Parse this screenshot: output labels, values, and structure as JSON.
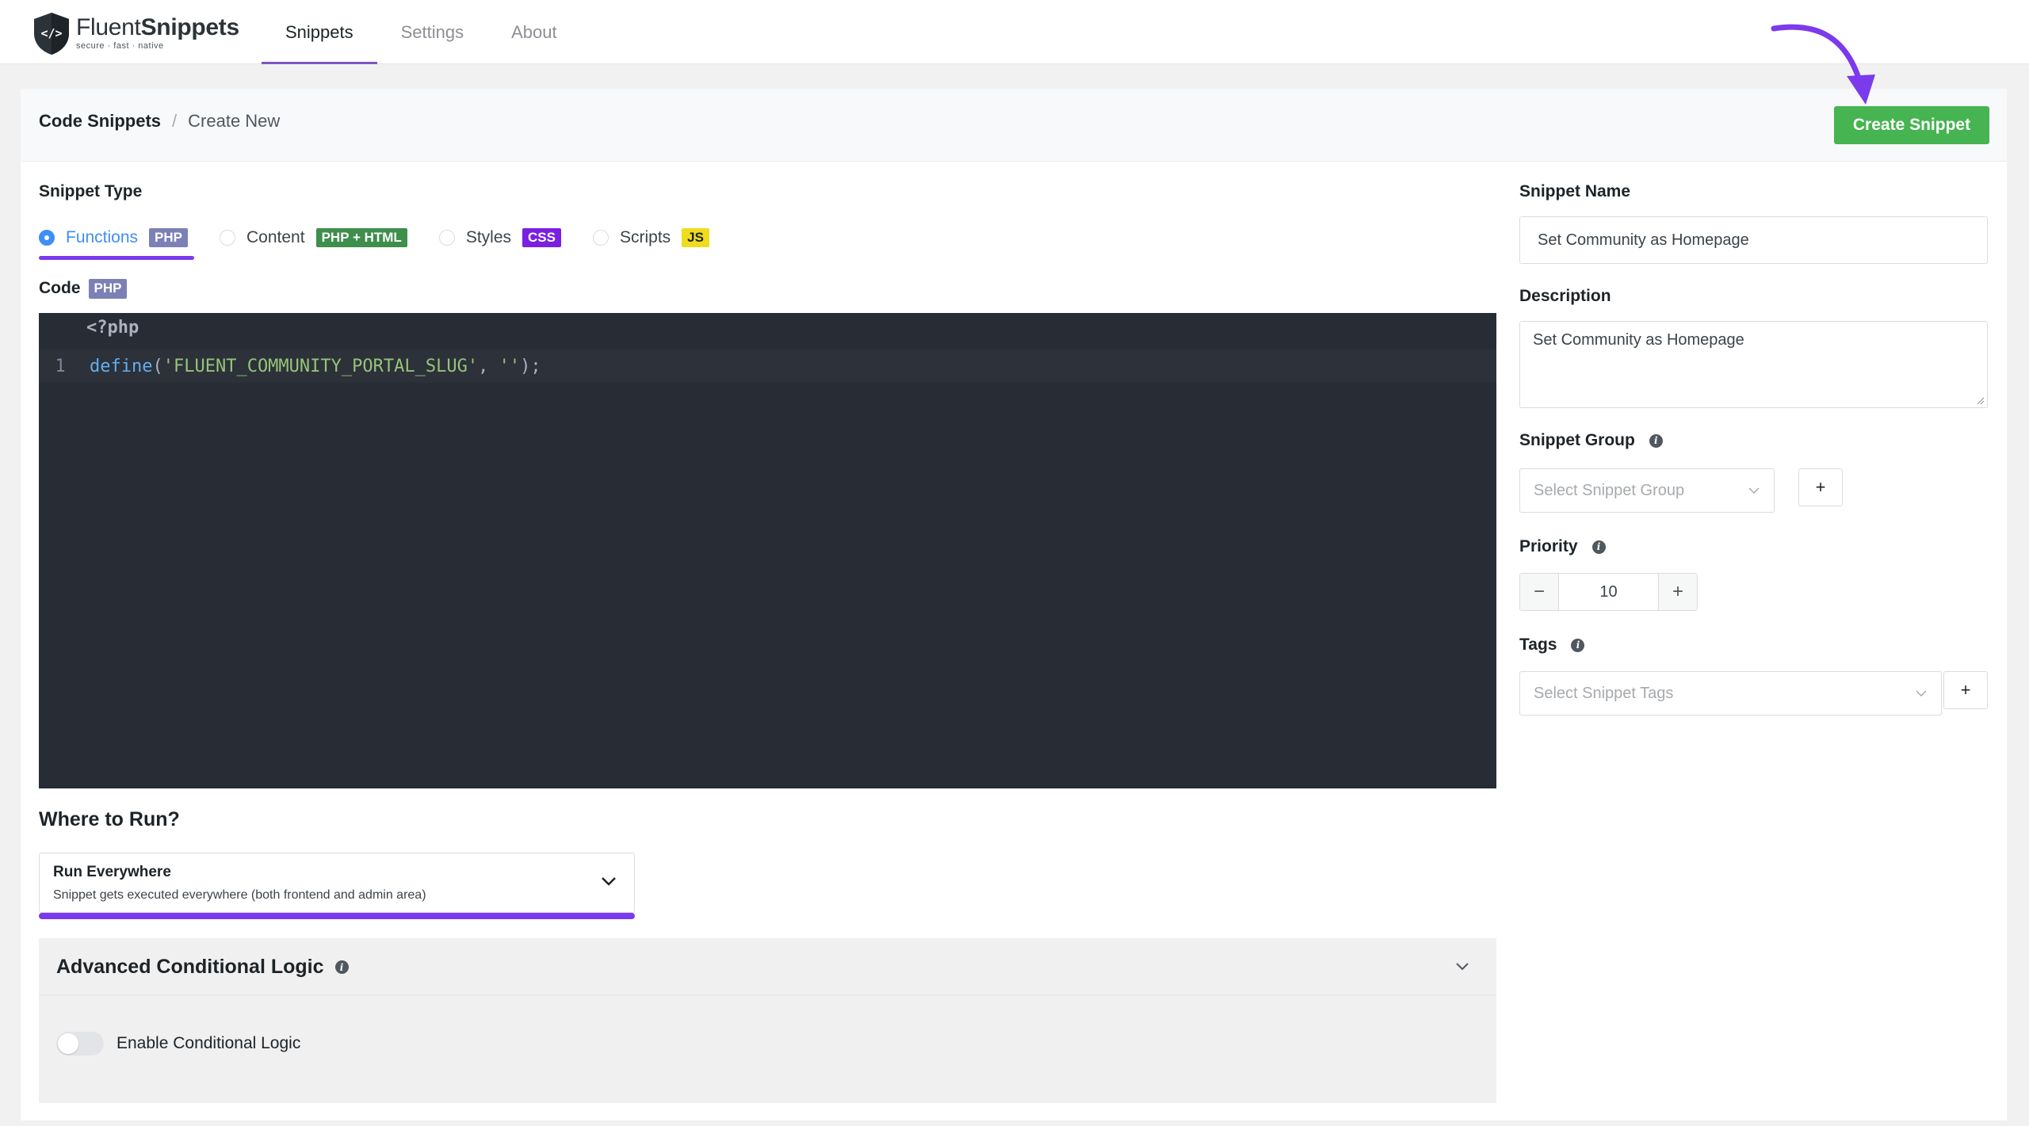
{
  "app": {
    "logo_name_light": "Fluent",
    "logo_name_bold": "Snippets",
    "logo_tagline": "secure · fast · native"
  },
  "nav": {
    "tabs": [
      {
        "label": "Snippets",
        "active": true
      },
      {
        "label": "Settings",
        "active": false
      },
      {
        "label": "About",
        "active": false
      }
    ]
  },
  "header": {
    "breadcrumb_root": "Code Snippets",
    "breadcrumb_sep": "/",
    "breadcrumb_current": "Create New",
    "create_button": "Create Snippet"
  },
  "snippet_type": {
    "label": "Snippet Type",
    "selected": "Functions",
    "options": [
      {
        "label": "Functions",
        "badge": "PHP"
      },
      {
        "label": "Content",
        "badge": "PHP + HTML"
      },
      {
        "label": "Styles",
        "badge": "CSS"
      },
      {
        "label": "Scripts",
        "badge": "JS"
      }
    ]
  },
  "code": {
    "label": "Code",
    "badge": "PHP",
    "opening_tag": "<?php",
    "lines": [
      {
        "number": "1",
        "fn": "define",
        "open": "(",
        "arg1": "'FLUENT_COMMUNITY_PORTAL_SLUG'",
        "comma": ", ",
        "arg2": "''",
        "close": ");"
      }
    ]
  },
  "where_to_run": {
    "label": "Where to Run?",
    "selected_title": "Run Everywhere",
    "selected_description": "Snippet gets executed everywhere (both frontend and admin area)"
  },
  "advanced": {
    "title": "Advanced Conditional Logic",
    "toggle_label": "Enable Conditional Logic",
    "enabled": false
  },
  "sidebar": {
    "name_label": "Snippet Name",
    "name_value": "Set Community as Homepage",
    "description_label": "Description",
    "description_value": "Set Community as Homepage",
    "group_label": "Snippet Group",
    "group_placeholder": "Select Snippet Group",
    "priority_label": "Priority",
    "priority_value": "10",
    "tags_label": "Tags",
    "tags_placeholder": "Select Snippet Tags",
    "add_symbol": "+",
    "minus_symbol": "−"
  },
  "colors": {
    "accent_purple": "#7c3aed",
    "create_green": "#46b450",
    "link_blue": "#3e8ef7",
    "editor_bg": "#282c34"
  },
  "icons": [
    "fluent-shield-logo-icon",
    "arrow-pointer-icon",
    "info-icon",
    "chevron-down-icon",
    "plus-icon",
    "minus-icon",
    "resize-grip-icon"
  ]
}
